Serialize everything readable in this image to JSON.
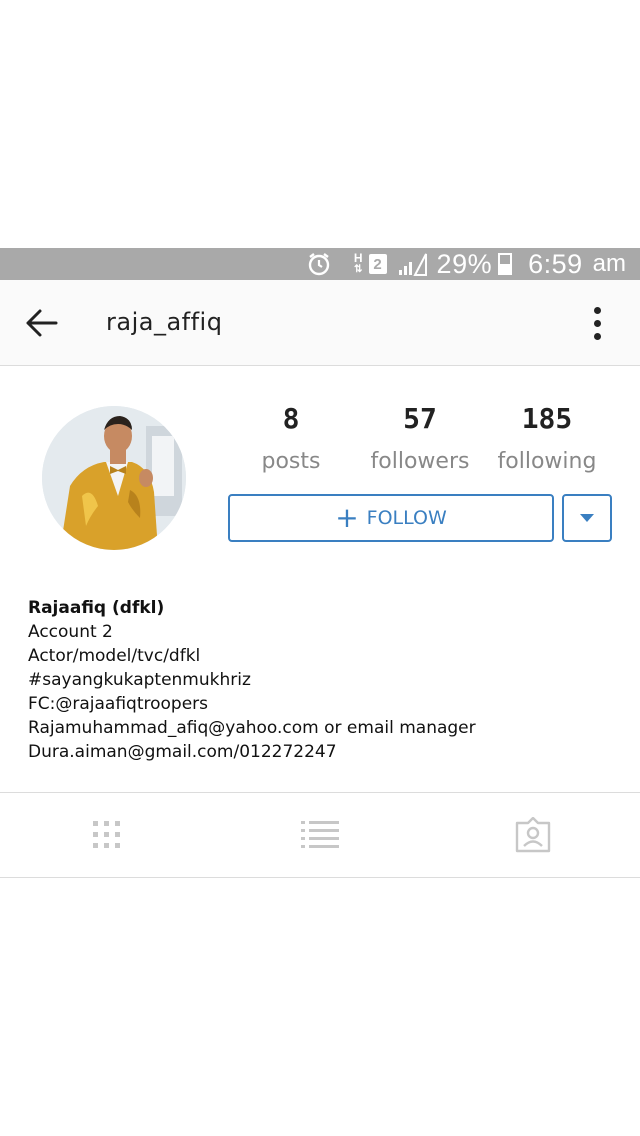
{
  "status_bar": {
    "network_h": "H",
    "sim_badge": "2",
    "battery_percent": "29%",
    "time": "6:59",
    "ampm": "am",
    "icons": [
      "alarm-icon",
      "data-arrows-icon",
      "signal-icon",
      "battery-icon"
    ]
  },
  "header": {
    "username": "raja_affiq",
    "icons": {
      "back": "arrow-left-icon",
      "menu": "more-vertical-icon"
    }
  },
  "stats": {
    "posts": {
      "value": "8",
      "label": "posts"
    },
    "followers": {
      "value": "57",
      "label": "followers"
    },
    "following": {
      "value": "185",
      "label": "following"
    }
  },
  "actions": {
    "follow_label": "FOLLOW",
    "follow_icon": "+",
    "accent": "#3a7fc1"
  },
  "bio": {
    "name": "Rajaafiq (dfkl)",
    "lines": [
      "Account 2",
      "Actor/model/tvc/dfkl",
      "#sayangkukaptenmukhriz",
      "FC:@rajaafiqtroopers",
      "Rajamuhammad_afiq@yahoo.com or email manager",
      "Dura.aiman@gmail.com/012272247"
    ]
  },
  "tabs": [
    {
      "icon": "grid-view-icon"
    },
    {
      "icon": "list-view-icon"
    },
    {
      "icon": "tagged-photos-icon"
    }
  ],
  "colors": {
    "status_bar_bg": "#a9a9a9",
    "header_bg": "#fafafa",
    "muted_text": "#888888",
    "tab_icon": "#c7c7c7"
  }
}
